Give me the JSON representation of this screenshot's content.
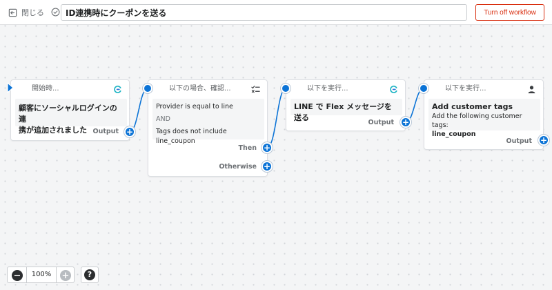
{
  "header": {
    "close_label": "閉じる",
    "workflow_title": "ID連携時にクーポンを送る",
    "turn_off_label": "Turn off workflow"
  },
  "nodes": {
    "trigger": {
      "head": "開始時...",
      "title_line1": "顧客にソーシャルログインの連",
      "title_line2": "携が追加されました",
      "output_label": "Output",
      "icon": "flow-logo-icon"
    },
    "condition": {
      "head": "以下の場合、確認...",
      "condition_1": "Provider is equal to line",
      "operator": "AND",
      "condition_2": "Tags does not include line_coupon",
      "then_label": "Then",
      "otherwise_label": "Otherwise",
      "icon": "checklist-icon"
    },
    "action_line": {
      "head": "以下を実行...",
      "title": "LINE で Flex メッセージを送る",
      "output_label": "Output",
      "icon": "flow-logo-icon"
    },
    "action_tags": {
      "head": "以下を実行...",
      "title": "Add customer tags",
      "description": "Add the following customer tags:",
      "tag": "line_coupon",
      "output_label": "Output",
      "icon": "person-icon"
    }
  },
  "zoom": {
    "level": "100%",
    "out_label": "−",
    "in_label": "+"
  },
  "help_label": "?",
  "colors": {
    "accent": "#0b73d6",
    "danger": "#d82c0d",
    "flow_logo": "#1fb5c4"
  }
}
